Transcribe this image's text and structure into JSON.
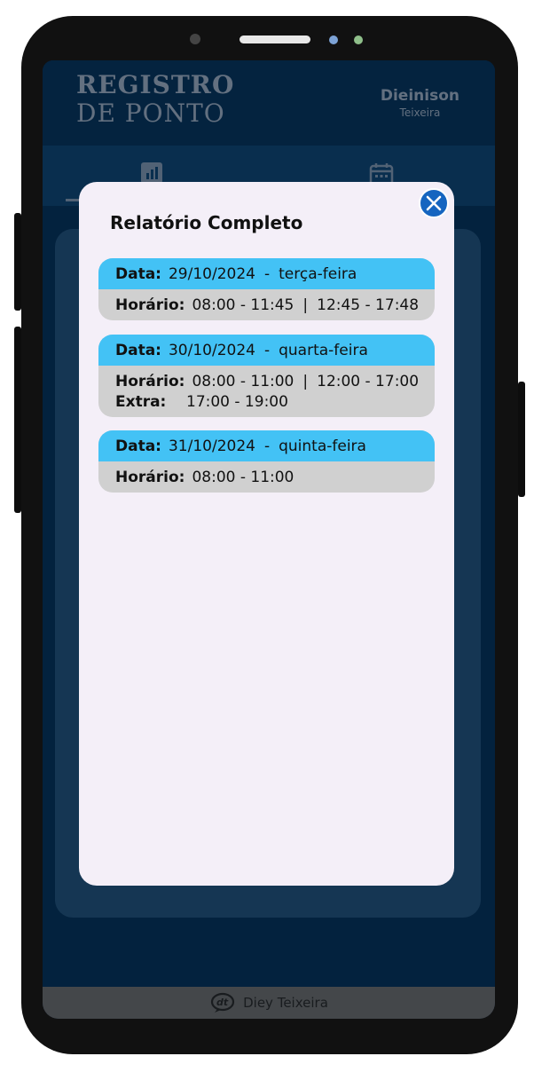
{
  "app": {
    "title_line1": "REGISTRO",
    "title_line2": "DE PONTO",
    "user_first": "Dieinison",
    "user_last": "Teixeira"
  },
  "tabs": [
    {
      "icon": "bar-chart-icon"
    },
    {
      "icon": "calendar-icon"
    }
  ],
  "modal": {
    "title": "Relatório Completo",
    "close_icon": "close-icon",
    "records": [
      {
        "date_label": "Data:",
        "date": "29/10/2024",
        "separator": "-",
        "weekday": "terça-feira",
        "hours_label": "Horário:",
        "hours_am": "08:00 - 11:45",
        "pipe": "|",
        "hours_pm": "12:45 - 17:48"
      },
      {
        "date_label": "Data:",
        "date": "30/10/2024",
        "separator": "-",
        "weekday": "quarta-feira",
        "hours_label": "Horário:",
        "hours_am": "08:00 - 11:00",
        "pipe": "|",
        "hours_pm": "12:00 - 17:00",
        "extra_label": "Extra:",
        "extra": "17:00 - 19:00"
      },
      {
        "date_label": "Data:",
        "date": "31/10/2024",
        "separator": "-",
        "weekday": "quinta-feira",
        "hours_label": "Horário:",
        "hours_am": "08:00 - 11:00"
      }
    ]
  },
  "footer": {
    "brand": "Diey Teixeira",
    "logo": "dt-logo-icon"
  },
  "colors": {
    "header_bg": "#062b4c",
    "date_strip": "#43c2f5",
    "record_bg": "#d0d0d0",
    "modal_bg": "#f4eff8",
    "close_button": "#1565c0"
  }
}
